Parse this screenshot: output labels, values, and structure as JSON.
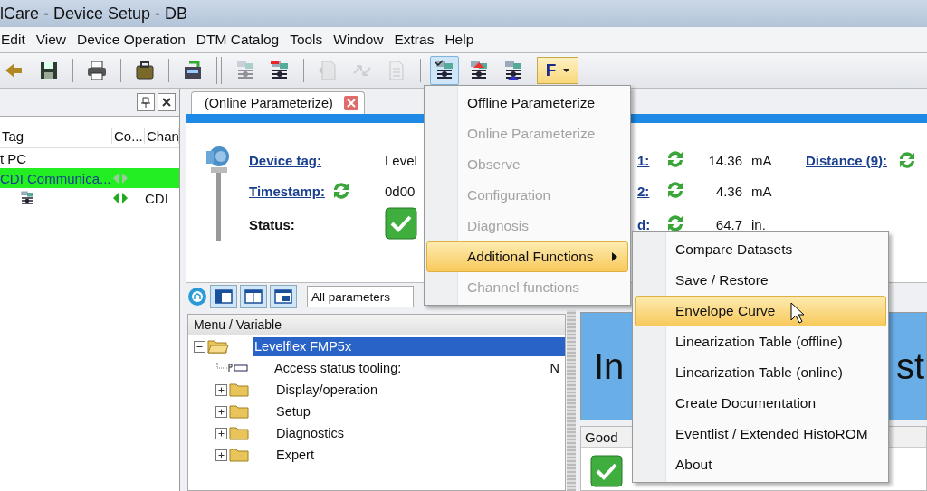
{
  "window": {
    "title": "lCare - Device Setup - DB"
  },
  "menu_bar": [
    "Edit",
    "View",
    "Device Operation",
    "DTM Catalog",
    "Tools",
    "Window",
    "Extras",
    "Help"
  ],
  "toolbar": [
    {
      "kind": "arrow",
      "disabled": false,
      "pressed": false
    },
    {
      "kind": "save",
      "disabled": false,
      "pressed": false
    },
    {
      "kind": "sep"
    },
    {
      "kind": "print",
      "disabled": false,
      "pressed": false
    },
    {
      "kind": "sep"
    },
    {
      "kind": "clipboard",
      "disabled": false,
      "pressed": false
    },
    {
      "kind": "sep"
    },
    {
      "kind": "device",
      "disabled": false,
      "pressed": false
    },
    {
      "kind": "grip"
    },
    {
      "kind": "network",
      "disabled": true,
      "pressed": false
    },
    {
      "kind": "network-red",
      "disabled": false,
      "pressed": false
    },
    {
      "kind": "sep"
    },
    {
      "kind": "upload",
      "disabled": true,
      "pressed": false
    },
    {
      "kind": "transfer",
      "disabled": true,
      "pressed": false
    },
    {
      "kind": "document",
      "disabled": true,
      "pressed": false
    },
    {
      "kind": "sep"
    },
    {
      "kind": "network-check",
      "disabled": false,
      "pressed": true
    },
    {
      "kind": "network-up",
      "disabled": false,
      "pressed": false
    },
    {
      "kind": "network-down",
      "disabled": false,
      "pressed": false
    }
  ],
  "function_button": {
    "label": "F",
    "open": true
  },
  "project": {
    "columns": [
      "Tag",
      "Co...",
      "Chan"
    ],
    "rows": [
      {
        "tag": "t PC",
        "kind": "host",
        "selected": false
      },
      {
        "tag": "CDI Communica...",
        "kind": "comm",
        "selected": true
      },
      {
        "kind": "device",
        "channel": "CDI",
        "selected": false
      }
    ]
  },
  "tab": {
    "label": "(Online Parameterize)"
  },
  "device_header": {
    "fields": [
      {
        "label": "Device tag:",
        "kind": "link",
        "value": "Level"
      },
      {
        "label": "Timestamp:",
        "kind": "link-refresh",
        "value": "0d00"
      },
      {
        "label": "Status:",
        "kind": "status",
        "good": true
      }
    ],
    "readings": [
      {
        "label": "1:",
        "value": "14.36",
        "unit": "mA"
      },
      {
        "label": "2:",
        "value": "4.36",
        "unit": "mA"
      },
      {
        "label": "d:",
        "value": "64.7",
        "unit": "in."
      }
    ],
    "distance_label": "Distance (9):"
  },
  "parameter_filter": "All parameters",
  "tree": {
    "header": "Menu / Variable",
    "items": [
      {
        "label": "Levelflex FMP5x",
        "kind": "folder",
        "expanded": true,
        "selected": true,
        "children": [
          {
            "label": "Access status tooling:",
            "kind": "parameter",
            "value": "N",
            "selected": false
          },
          {
            "label": "Display/operation",
            "kind": "folder",
            "expanded": false,
            "selected": false
          },
          {
            "label": "Setup",
            "kind": "folder",
            "expanded": false,
            "selected": false
          },
          {
            "label": "Diagnostics",
            "kind": "folder",
            "expanded": false,
            "selected": false
          },
          {
            "label": "Expert",
            "kind": "folder",
            "expanded": false,
            "selected": false
          }
        ]
      }
    ]
  },
  "banner": {
    "left": "In",
    "right": "st"
  },
  "status_panel": {
    "label": "Good",
    "good": true
  },
  "function_menu": {
    "items": [
      {
        "label": "Offline Parameterize",
        "disabled": false,
        "selected": false,
        "submenu": false
      },
      {
        "label": "Online Parameterize",
        "disabled": true,
        "selected": false,
        "submenu": false
      },
      {
        "label": "Observe",
        "disabled": true,
        "selected": false,
        "submenu": false
      },
      {
        "label": "Configuration",
        "disabled": true,
        "selected": false,
        "submenu": false
      },
      {
        "label": "Diagnosis",
        "disabled": true,
        "selected": false,
        "submenu": false
      },
      {
        "label": "Additional Functions",
        "disabled": false,
        "selected": true,
        "submenu": true
      },
      {
        "label": "Channel functions",
        "disabled": true,
        "selected": false,
        "submenu": false
      }
    ]
  },
  "submenu": {
    "items": [
      {
        "label": "Compare Datasets",
        "selected": false
      },
      {
        "label": "Save / Restore",
        "selected": false
      },
      {
        "label": "Envelope Curve",
        "selected": true
      },
      {
        "label": "Linearization Table (offline)",
        "selected": false
      },
      {
        "label": "Linearization Table (online)",
        "selected": false
      },
      {
        "label": "Create Documentation",
        "selected": false
      },
      {
        "label": "Eventlist / Extended HistoROM",
        "selected": false
      },
      {
        "label": "About",
        "selected": false
      }
    ]
  }
}
